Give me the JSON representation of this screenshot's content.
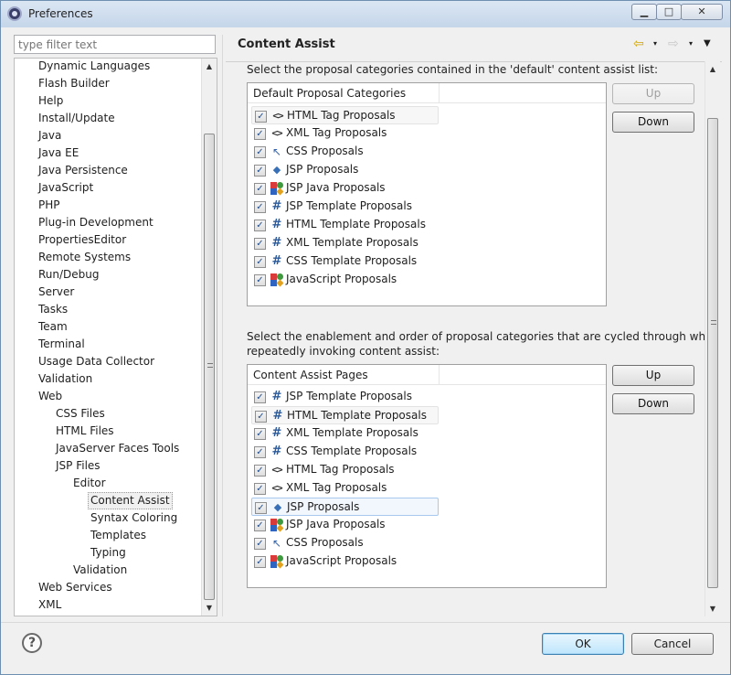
{
  "window": {
    "title": "Preferences",
    "min_label": "▁",
    "max_label": "□",
    "close_label": "✕"
  },
  "filter": {
    "placeholder": "type filter text"
  },
  "tree": {
    "items": [
      "Dynamic Languages",
      "Flash Builder",
      "Help",
      "Install/Update",
      "Java",
      "Java EE",
      "Java Persistence",
      "JavaScript",
      "PHP",
      "Plug-in Development",
      "PropertiesEditor",
      "Remote Systems",
      "Run/Debug",
      "Server",
      "Tasks",
      "Team",
      "Terminal",
      "Usage Data Collector",
      "Validation",
      "Web",
      "CSS Files",
      "HTML Files",
      "JavaServer Faces Tools",
      "JSP Files",
      "Editor",
      "Content Assist",
      "Syntax Coloring",
      "Templates",
      "Typing",
      "Validation",
      "Web Services",
      "XML"
    ],
    "selected": "Content Assist"
  },
  "page": {
    "title": "Content Assist"
  },
  "nav": {
    "back": "⇦",
    "forward": "⇨",
    "dropdown": "▾",
    "menu": "▼"
  },
  "section1": {
    "description": "Select the proposal categories contained in the 'default' content assist list:",
    "column": "Default Proposal Categories",
    "rows": [
      {
        "label": "HTML Tag Proposals",
        "icon": "tag-icon"
      },
      {
        "label": "XML Tag Proposals",
        "icon": "tag-icon"
      },
      {
        "label": "CSS Proposals",
        "icon": "css-icon"
      },
      {
        "label": "JSP Proposals",
        "icon": "jsp-icon"
      },
      {
        "label": "JSP Java Proposals",
        "icon": "multi-icon"
      },
      {
        "label": "JSP Template Proposals",
        "icon": "hash-icon"
      },
      {
        "label": "HTML Template Proposals",
        "icon": "hash-icon"
      },
      {
        "label": "XML Template Proposals",
        "icon": "hash-icon"
      },
      {
        "label": "CSS Template Proposals",
        "icon": "hash-icon"
      },
      {
        "label": "JavaScript Proposals",
        "icon": "multi-icon"
      }
    ],
    "up": "Up",
    "down": "Down"
  },
  "section2": {
    "description_line1": "Select the enablement and order of proposal categories that are cycled through when",
    "description_line2": "repeatedly invoking content assist:",
    "column": "Content Assist Pages",
    "rows": [
      {
        "label": "JSP Template Proposals",
        "icon": "hash-icon"
      },
      {
        "label": "HTML Template Proposals",
        "icon": "hash-icon"
      },
      {
        "label": "XML Template Proposals",
        "icon": "hash-icon"
      },
      {
        "label": "CSS Template Proposals",
        "icon": "hash-icon"
      },
      {
        "label": "HTML Tag Proposals",
        "icon": "tag-icon"
      },
      {
        "label": "XML Tag Proposals",
        "icon": "tag-icon"
      },
      {
        "label": "JSP Proposals",
        "icon": "jsp-icon"
      },
      {
        "label": "JSP Java Proposals",
        "icon": "multi-icon"
      },
      {
        "label": "CSS Proposals",
        "icon": "css-icon"
      },
      {
        "label": "JavaScript Proposals",
        "icon": "multi-icon"
      }
    ],
    "up": "Up",
    "down": "Down"
  },
  "buttons": {
    "help": "?",
    "ok": "OK",
    "cancel": "Cancel"
  },
  "glyphs": {
    "check": "✓",
    "tag": "<>",
    "hash": "#",
    "css": "↖",
    "jsp": "◆",
    "scroll_up": "▲",
    "scroll_down": "▼"
  }
}
